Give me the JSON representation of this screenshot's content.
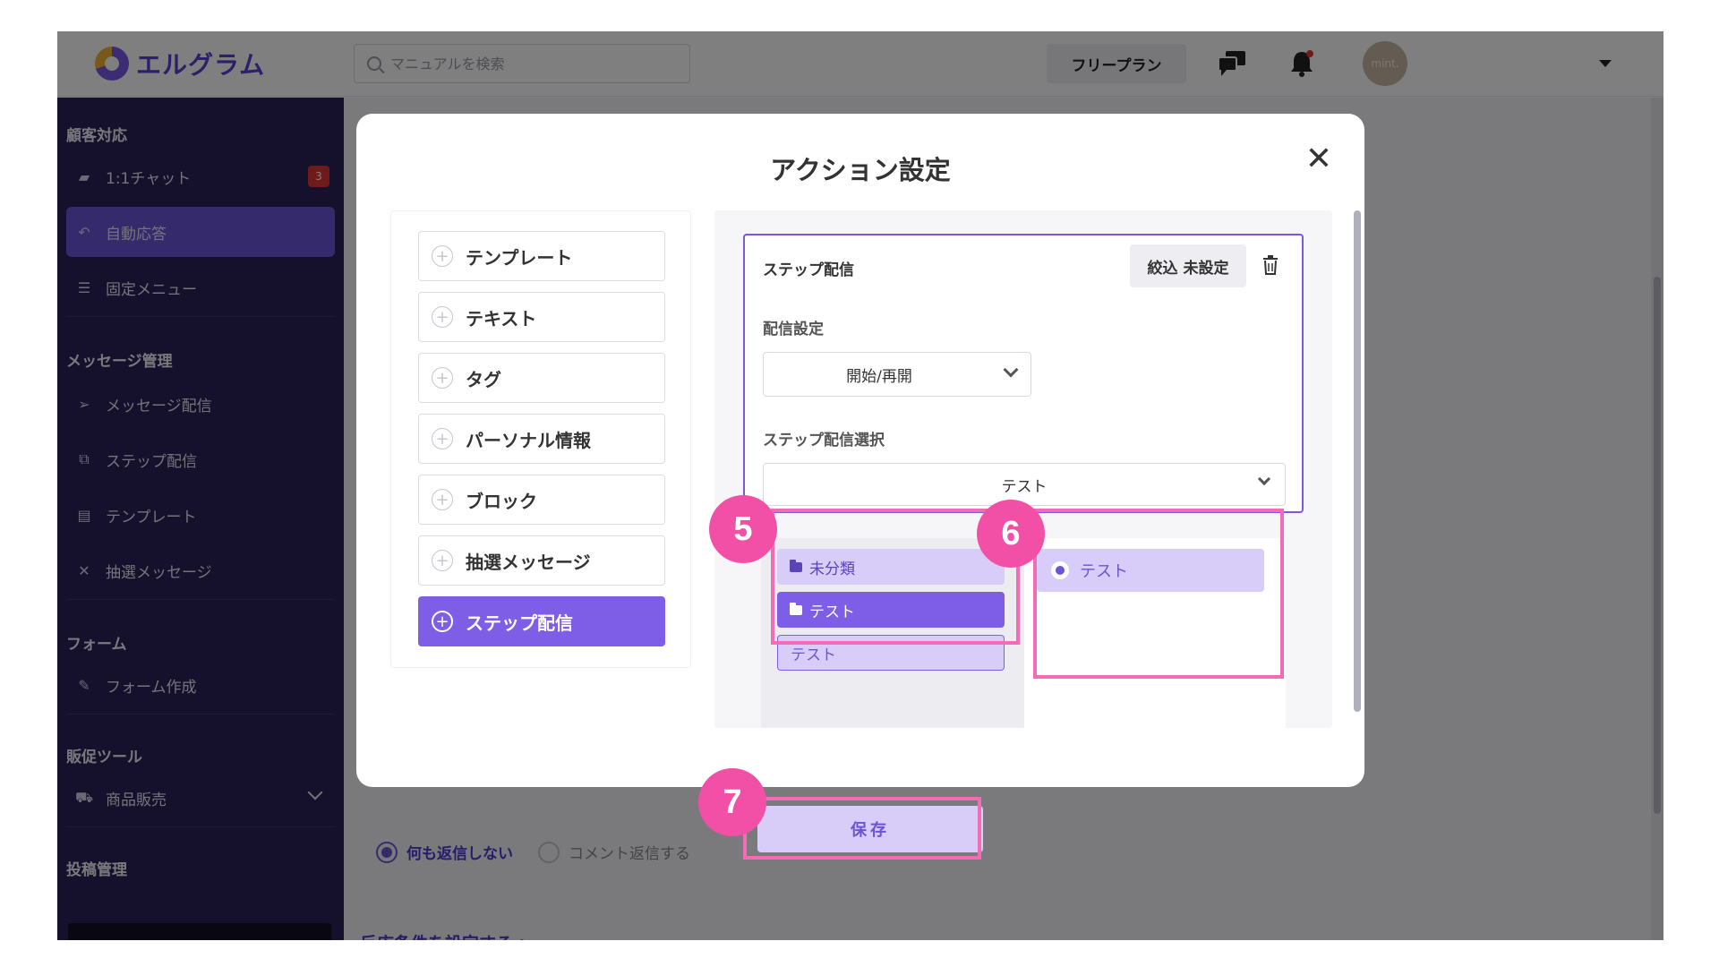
{
  "app": {
    "logo_text": "エルグラム"
  },
  "topbar": {
    "search_placeholder": "マニュアルを検索",
    "plan_label": "フリープラン",
    "avatar_text": "mint."
  },
  "sidebar": {
    "sections": {
      "customer": "顧客対応",
      "message": "メッセージ管理",
      "form": "フォーム",
      "promo": "販促ツール",
      "post": "投稿管理"
    },
    "items": {
      "chat": "1:1チャット",
      "chat_badge": "3",
      "auto_reply": "自動応答",
      "fixed_menu": "固定メニュー",
      "message_delivery": "メッセージ配信",
      "step_delivery": "ステップ配信",
      "template": "テンプレート",
      "lottery": "抽選メッセージ",
      "form_create": "フォーム作成",
      "product_sales": "商品販売"
    },
    "collapse_label": "≤"
  },
  "main": {
    "radio_no_reply": "何も返信しない",
    "radio_comment_reply": "コメント返信する",
    "condition_link": "反応条件を設定する >"
  },
  "modal": {
    "title": "アクション設定",
    "close_label": "✕",
    "actions": [
      "テンプレート",
      "テキスト",
      "タグ",
      "パーソナル情報",
      "ブロック",
      "抽選メッセージ",
      "ステップ配信"
    ],
    "step_card": {
      "title": "ステップ配信",
      "filter_label": "絞込 未設定",
      "delivery_setting_label": "配信設定",
      "delivery_setting_value": "開始/再開",
      "step_select_label": "ステップ配信選択",
      "step_select_value": "テスト"
    },
    "cascade": {
      "folder_uncategorized": "未分類",
      "folder_test": "テスト",
      "folder_leaf": "テスト",
      "option_selected": "テスト"
    }
  },
  "save_label": "保存",
  "annotations": {
    "n5": "5",
    "n6": "6",
    "n7": "7"
  },
  "colors": {
    "accent": "#7e5ee6",
    "sidebar_bg": "#2a2157",
    "highlight": "#f26bb5",
    "step_badge": "#f24fa6"
  }
}
